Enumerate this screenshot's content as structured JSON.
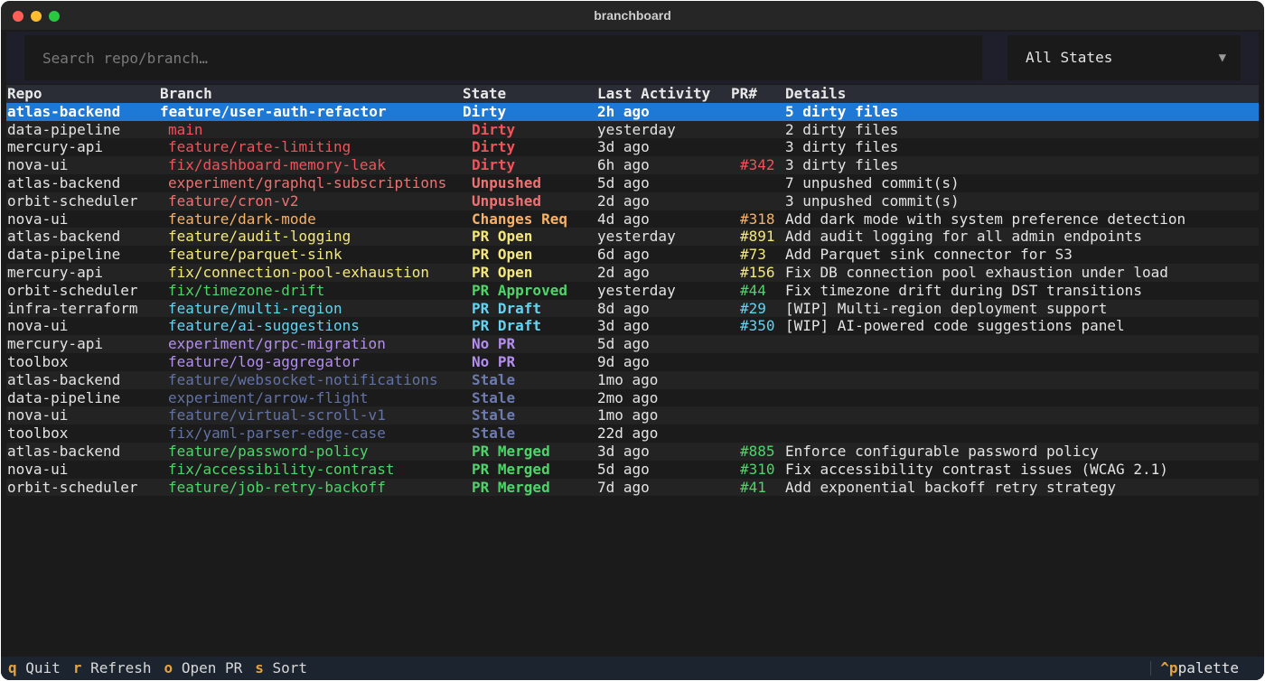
{
  "window": {
    "title": "branchboard"
  },
  "toolbar": {
    "search_placeholder": "Search repo/branch…",
    "state_filter": "All States"
  },
  "table": {
    "headers": {
      "repo": "Repo",
      "branch": "Branch",
      "state": "State",
      "activity": "Last Activity",
      "pr": "PR#",
      "details": "Details"
    },
    "rows": [
      {
        "repo": "atlas-backend",
        "branch": "feature/user-auth-refactor",
        "state": "Dirty",
        "activity": "2h ago",
        "pr": "",
        "details": "5 dirty files",
        "branch_color": "#ffffff",
        "state_color": "#ffffff",
        "pr_color": "#ffffff",
        "selected": true
      },
      {
        "repo": "data-pipeline",
        "branch": "main",
        "state": "Dirty",
        "activity": "yesterday",
        "pr": "",
        "details": "2 dirty files",
        "branch_color": "#f0535a",
        "state_color": "#f0535a",
        "pr_color": "#f0535a"
      },
      {
        "repo": "mercury-api",
        "branch": "feature/rate-limiting",
        "state": "Dirty",
        "activity": "3d ago",
        "pr": "",
        "details": "3 dirty files",
        "branch_color": "#f0535a",
        "state_color": "#f0535a",
        "pr_color": "#f0535a"
      },
      {
        "repo": "nova-ui",
        "branch": "fix/dashboard-memory-leak",
        "state": "Dirty",
        "activity": "6h ago",
        "pr": "#342",
        "details": "3 dirty files",
        "branch_color": "#f0535a",
        "state_color": "#f0535a",
        "pr_color": "#f0535a"
      },
      {
        "repo": "atlas-backend",
        "branch": "experiment/graphql-subscriptions",
        "state": "Unpushed",
        "activity": "5d ago",
        "pr": "",
        "details": "7 unpushed commit(s)",
        "branch_color": "#f07171",
        "state_color": "#f07171",
        "pr_color": "#f07171"
      },
      {
        "repo": "orbit-scheduler",
        "branch": "feature/cron-v2",
        "state": "Unpushed",
        "activity": "2d ago",
        "pr": "",
        "details": "3 unpushed commit(s)",
        "branch_color": "#f07171",
        "state_color": "#f07171",
        "pr_color": "#f07171"
      },
      {
        "repo": "nova-ui",
        "branch": "feature/dark-mode",
        "state": "Changes Req",
        "activity": "4d ago",
        "pr": "#318",
        "details": "Add dark mode with system preference detection",
        "branch_color": "#f7b267",
        "state_color": "#f7b267",
        "pr_color": "#f7b267"
      },
      {
        "repo": "atlas-backend",
        "branch": "feature/audit-logging",
        "state": "PR Open",
        "activity": "yesterday",
        "pr": "#891",
        "details": "Add audit logging for all admin endpoints",
        "branch_color": "#f4e87c",
        "state_color": "#f4e87c",
        "pr_color": "#f4e87c"
      },
      {
        "repo": "data-pipeline",
        "branch": "feature/parquet-sink",
        "state": "PR Open",
        "activity": "6d ago",
        "pr": "#73",
        "details": "Add Parquet sink connector for S3",
        "branch_color": "#f4e87c",
        "state_color": "#f4e87c",
        "pr_color": "#f4e87c"
      },
      {
        "repo": "mercury-api",
        "branch": "fix/connection-pool-exhaustion",
        "state": "PR Open",
        "activity": "2d ago",
        "pr": "#156",
        "details": "Fix DB connection pool exhaustion under load",
        "branch_color": "#f4e87c",
        "state_color": "#f4e87c",
        "pr_color": "#f4e87c"
      },
      {
        "repo": "orbit-scheduler",
        "branch": "fix/timezone-drift",
        "state": "PR Approved",
        "activity": "yesterday",
        "pr": "#44",
        "details": "Fix timezone drift during DST transitions",
        "branch_color": "#4fd46a",
        "state_color": "#4fd46a",
        "pr_color": "#4fd46a"
      },
      {
        "repo": "infra-terraform",
        "branch": "feature/multi-region",
        "state": "PR Draft",
        "activity": "8d ago",
        "pr": "#29",
        "details": "[WIP] Multi-region deployment support",
        "branch_color": "#63d3f0",
        "state_color": "#63d3f0",
        "pr_color": "#63d3f0"
      },
      {
        "repo": "nova-ui",
        "branch": "feature/ai-suggestions",
        "state": "PR Draft",
        "activity": "3d ago",
        "pr": "#350",
        "details": "[WIP] AI-powered code suggestions panel",
        "branch_color": "#63d3f0",
        "state_color": "#63d3f0",
        "pr_color": "#63d3f0"
      },
      {
        "repo": "mercury-api",
        "branch": "experiment/grpc-migration",
        "state": "No PR",
        "activity": "5d ago",
        "pr": "",
        "details": "",
        "branch_color": "#b48ef0",
        "state_color": "#b48ef0",
        "pr_color": "#b48ef0"
      },
      {
        "repo": "toolbox",
        "branch": "feature/log-aggregator",
        "state": "No PR",
        "activity": "9d ago",
        "pr": "",
        "details": "",
        "branch_color": "#b48ef0",
        "state_color": "#b48ef0",
        "pr_color": "#b48ef0"
      },
      {
        "repo": "atlas-backend",
        "branch": "feature/websocket-notifications",
        "state": "Stale",
        "activity": "1mo ago",
        "pr": "",
        "details": "",
        "branch_color": "#6272a4",
        "state_color": "#6d7bb0",
        "pr_color": "#6272a4"
      },
      {
        "repo": "data-pipeline",
        "branch": "experiment/arrow-flight",
        "state": "Stale",
        "activity": "2mo ago",
        "pr": "",
        "details": "",
        "branch_color": "#6272a4",
        "state_color": "#6d7bb0",
        "pr_color": "#6272a4"
      },
      {
        "repo": "nova-ui",
        "branch": "feature/virtual-scroll-v1",
        "state": "Stale",
        "activity": "1mo ago",
        "pr": "",
        "details": "",
        "branch_color": "#6272a4",
        "state_color": "#6d7bb0",
        "pr_color": "#6272a4"
      },
      {
        "repo": "toolbox",
        "branch": "fix/yaml-parser-edge-case",
        "state": "Stale",
        "activity": "22d ago",
        "pr": "",
        "details": "",
        "branch_color": "#6272a4",
        "state_color": "#6d7bb0",
        "pr_color": "#6272a4"
      },
      {
        "repo": "atlas-backend",
        "branch": "feature/password-policy",
        "state": "PR Merged",
        "activity": "3d ago",
        "pr": "#885",
        "details": "Enforce configurable password policy",
        "branch_color": "#4fd46a",
        "state_color": "#4fd46a",
        "pr_color": "#4fd46a"
      },
      {
        "repo": "nova-ui",
        "branch": "fix/accessibility-contrast",
        "state": "PR Merged",
        "activity": "5d ago",
        "pr": "#310",
        "details": "Fix accessibility contrast issues (WCAG 2.1)",
        "branch_color": "#4fd46a",
        "state_color": "#4fd46a",
        "pr_color": "#4fd46a"
      },
      {
        "repo": "orbit-scheduler",
        "branch": "feature/job-retry-backoff",
        "state": "PR Merged",
        "activity": "7d ago",
        "pr": "#41",
        "details": "Add exponential backoff retry strategy",
        "branch_color": "#4fd46a",
        "state_color": "#4fd46a",
        "pr_color": "#4fd46a"
      }
    ]
  },
  "statusbar": {
    "keys": [
      {
        "key": "q",
        "label": "Quit"
      },
      {
        "key": "r",
        "label": "Refresh"
      },
      {
        "key": "o",
        "label": "Open PR"
      },
      {
        "key": "s",
        "label": "Sort"
      }
    ],
    "palette_key": "^p",
    "palette_label": "palette"
  },
  "colors": {
    "accent": "#1e78d6",
    "key": "#e6a23c"
  }
}
